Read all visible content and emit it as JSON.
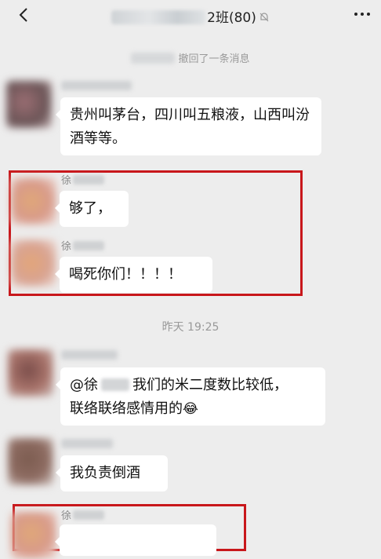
{
  "header": {
    "title_suffix": "2班(80)",
    "icons": {
      "back": "chevron-left-icon",
      "mute": "mute-bell-icon",
      "more": "more-dots-icon"
    }
  },
  "system_messages": {
    "recall": "撤回了一条消息",
    "timestamp": "昨天 19:25"
  },
  "messages": [
    {
      "sender": "",
      "text": "贵州叫茅台，四川叫五粮液，山西叫汾酒等等。"
    },
    {
      "sender": "徐",
      "text": "够了，"
    },
    {
      "sender": "徐",
      "text": "喝死你们！！！！"
    },
    {
      "sender": "",
      "mention_prefix": "@徐",
      "text_line1": "我们的米二度数比较低，",
      "text_line2": "联络联络感情用的",
      "emoji": "😂"
    },
    {
      "sender": "",
      "text": "我负责倒酒"
    },
    {
      "sender": "徐",
      "text": ""
    }
  ],
  "colors": {
    "background": "#ededed",
    "bubble": "#ffffff",
    "highlight": "#c8171b",
    "system_text": "#999999"
  }
}
